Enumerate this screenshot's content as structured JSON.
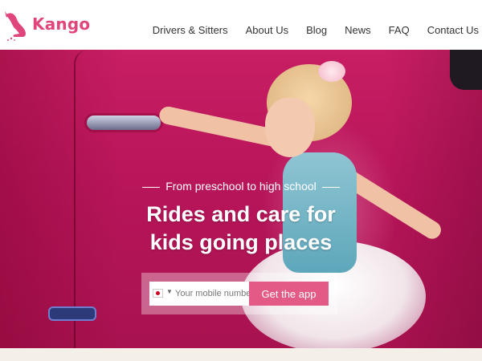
{
  "brand": {
    "name": "Kango",
    "accent": "#e0457b"
  },
  "nav": {
    "items": [
      {
        "label": "Drivers & Sitters"
      },
      {
        "label": "About Us"
      },
      {
        "label": "Blog"
      },
      {
        "label": "News"
      },
      {
        "label": "FAQ"
      },
      {
        "label": "Contact Us"
      }
    ]
  },
  "hero": {
    "tagline": "From preschool to high school",
    "headline_line1": "Rides and care for",
    "headline_line2": "kids going places"
  },
  "form": {
    "country_flag": "japan-flag-icon",
    "phone_placeholder": "Your mobile number",
    "button_label": "Get the app",
    "button_color": "#e45a87"
  }
}
